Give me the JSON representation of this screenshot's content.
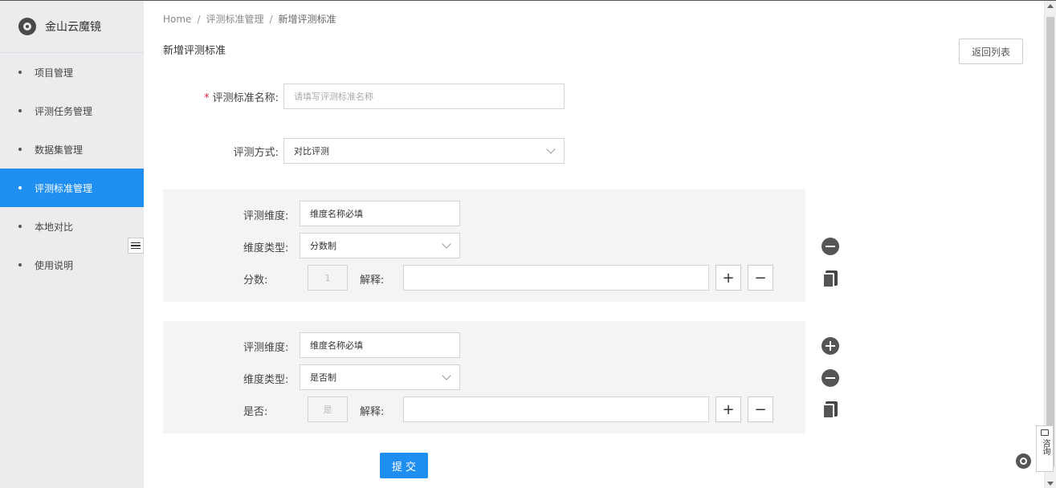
{
  "app": {
    "name": "金山云魔镜"
  },
  "sidebar": {
    "items": [
      {
        "label": "项目管理",
        "active": false
      },
      {
        "label": "评测任务管理",
        "active": false
      },
      {
        "label": "数据集管理",
        "active": false
      },
      {
        "label": "评测标准管理",
        "active": true
      },
      {
        "label": "本地对比",
        "active": false
      },
      {
        "label": "使用说明",
        "active": false
      }
    ]
  },
  "breadcrumb": [
    "Home",
    "评测标准管理",
    "新增评测标准"
  ],
  "page": {
    "title": "新增评测标准",
    "back_label": "返回列表"
  },
  "form": {
    "name_label": "评测标准名称:",
    "name_placeholder": "请填写评测标准名称",
    "method_label": "评测方式:",
    "method_value": "对比评测"
  },
  "dimensions": [
    {
      "dim_label": "评测维度:",
      "dim_value": "维度名称必填",
      "type_label": "维度类型:",
      "type_value": "分数制",
      "score_label": "分数:",
      "score_value": "1",
      "explain_label": "解释:",
      "explain_value": ""
    },
    {
      "dim_label": "评测维度:",
      "dim_value": "维度名称必填",
      "type_label": "维度类型:",
      "type_value": "是否制",
      "score_label": "是否:",
      "score_value": "是",
      "explain_label": "解释:",
      "explain_value": ""
    }
  ],
  "buttons": {
    "plus": "+",
    "minus": "−",
    "submit": "提 交"
  },
  "widgets": {
    "consult": "咨询"
  },
  "colors": {
    "accent": "#1e8ff0",
    "sidebar_bg": "#ececee",
    "panel_bg": "#f4f4f4"
  }
}
